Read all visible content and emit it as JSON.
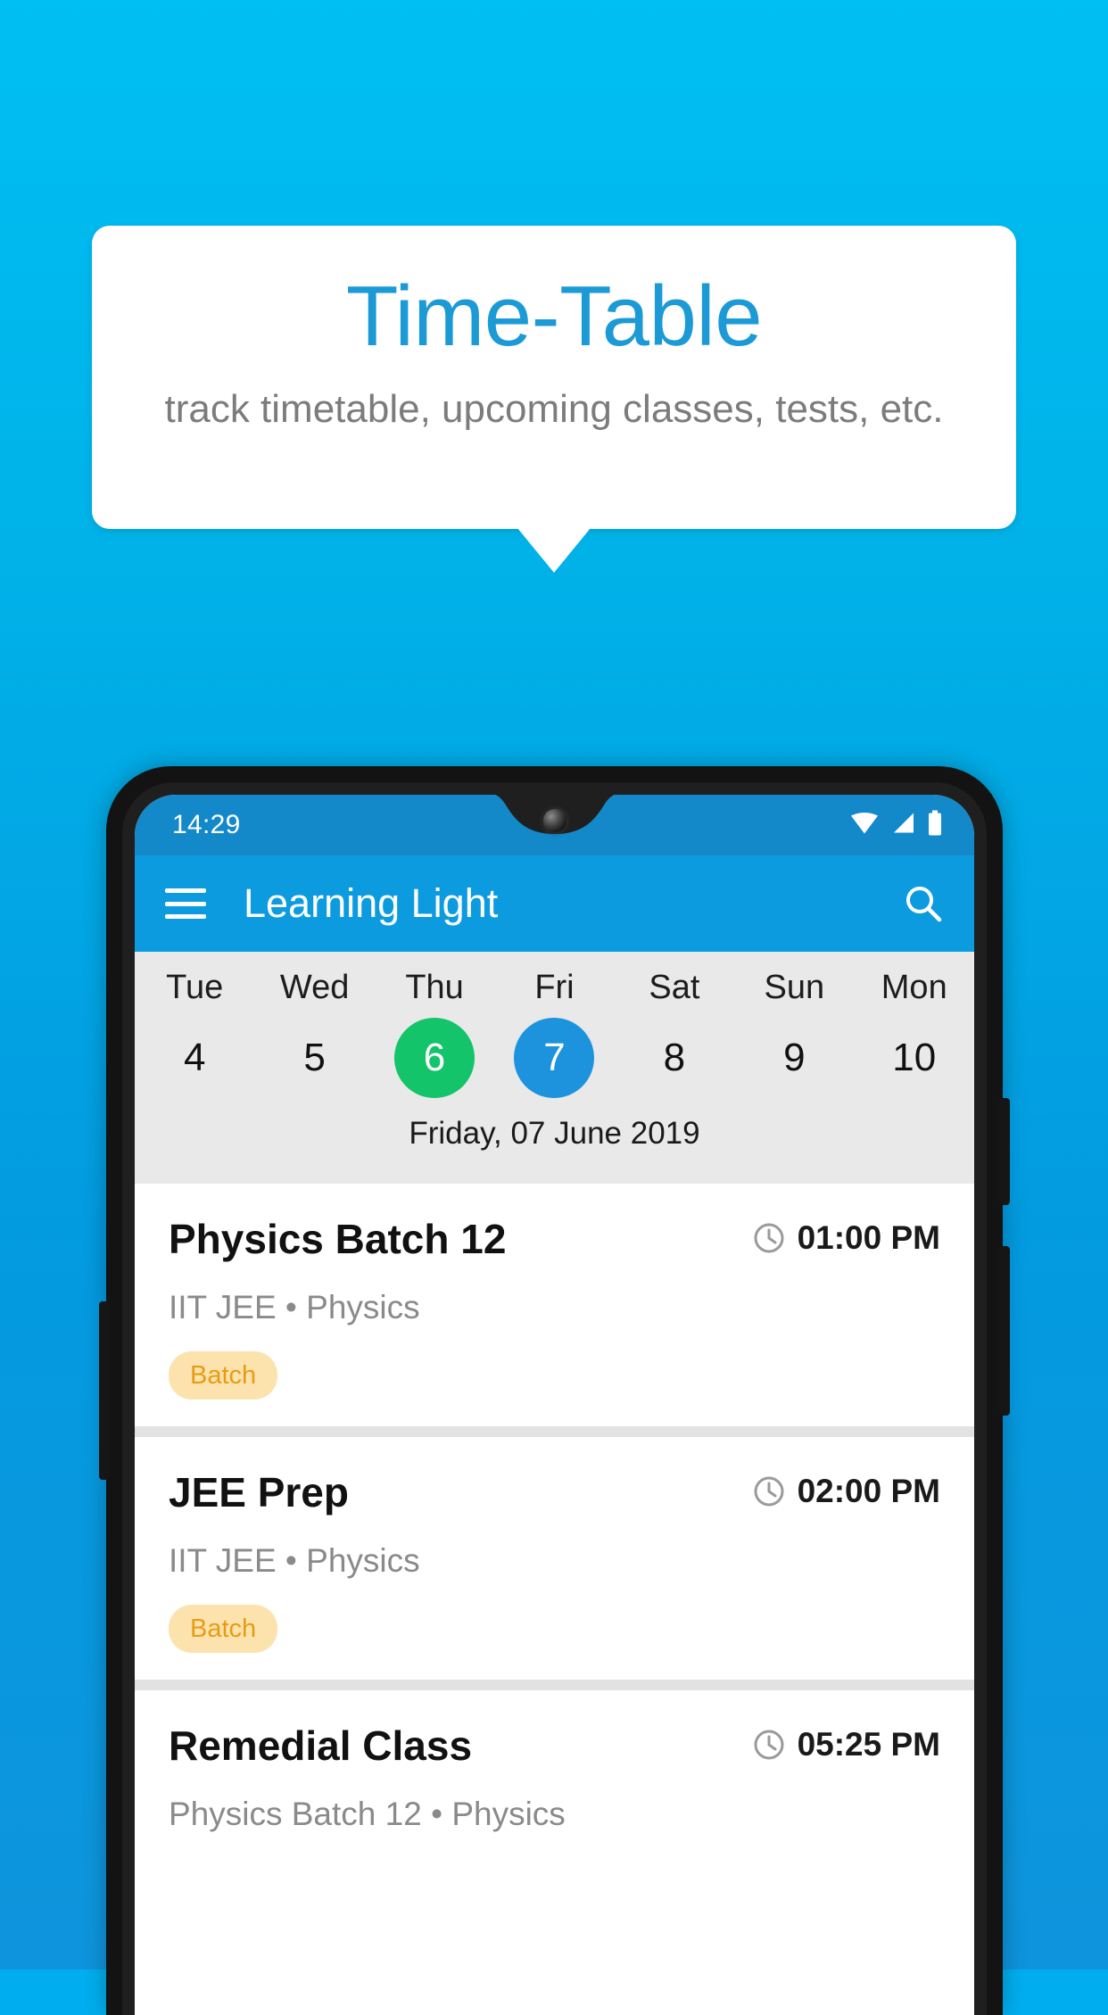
{
  "promo": {
    "title": "Time-Table",
    "subtitle": "track timetable, upcoming classes, tests, etc.",
    "title_color": "#1C9AD6",
    "background_color": "#00BFF3"
  },
  "phone": {
    "status_bar": {
      "time": "14:29",
      "icons": [
        "wifi-icon",
        "signal-icon",
        "battery-icon"
      ],
      "background_color": "#1389CA"
    },
    "app_bar": {
      "menu_icon": "hamburger-menu-icon",
      "title": "Learning Light",
      "search_icon": "search-icon",
      "background_color": "#0D9BE0"
    },
    "date_strip": {
      "days": [
        {
          "name": "Tue",
          "num": "4",
          "state": "normal"
        },
        {
          "name": "Wed",
          "num": "5",
          "state": "normal"
        },
        {
          "name": "Thu",
          "num": "6",
          "state": "today"
        },
        {
          "name": "Fri",
          "num": "7",
          "state": "selected"
        },
        {
          "name": "Sat",
          "num": "8",
          "state": "normal"
        },
        {
          "name": "Sun",
          "num": "9",
          "state": "normal"
        },
        {
          "name": "Mon",
          "num": "10",
          "state": "normal"
        }
      ],
      "today_color": "#14C46B",
      "selected_color": "#1C93DC",
      "caption": "Friday, 07 June 2019"
    },
    "cards": [
      {
        "title": "Physics Batch 12",
        "time": "01:00 PM",
        "time_icon": "clock-icon",
        "subtitle": "IIT JEE • Physics",
        "badge": "Batch"
      },
      {
        "title": "JEE Prep",
        "time": "02:00 PM",
        "time_icon": "clock-icon",
        "subtitle": "IIT JEE • Physics",
        "badge": "Batch"
      },
      {
        "title": "Remedial Class",
        "time": "05:25 PM",
        "time_icon": "clock-icon",
        "subtitle": "Physics Batch 12 • Physics",
        "badge": ""
      }
    ]
  }
}
